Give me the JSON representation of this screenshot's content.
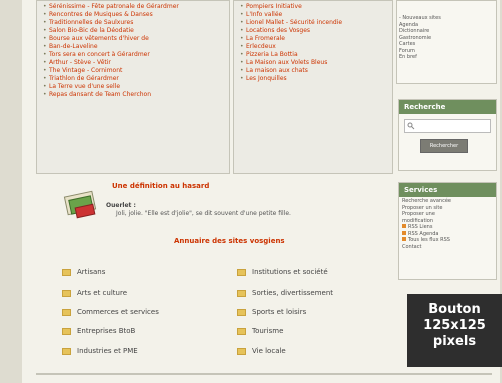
{
  "left_links": [
    "Sérénissime - Fête patronale de Gérardmer",
    "Rencontres de Musiques & Danses",
    "Traditionnelles de Saulxures",
    "Salon Bio-Bic de la Déodatie",
    "Bourse aux vêtements d'hiver de",
    "Ban-de-Laveline",
    "Tors sera en concert à Gérardmer",
    "Arthur - Stève - Vêtir",
    "The Vintage - Cornimont",
    "Triathlon de Gérardmer",
    "La Terre vue d'une selle",
    "Repas dansant de Team Cherchon"
  ],
  "middle_links": [
    "Pompiers Initiative",
    "L'Info vallée",
    "Lionel Mallet - Sécurité incendie",
    "Locations des Vosges",
    "La Fromerale",
    "Erlecdeux",
    "Pizzeria La Bottia",
    "La Maison aux Volets Bleus",
    "La maison aux chats",
    "Les Jonquilles"
  ],
  "sidebar_top": [
    "- Nouveaux sites",
    "Agenda",
    "Dictionnaire",
    "Gastronomie",
    "Cartes",
    "Forum",
    "En bref"
  ],
  "recherche": {
    "title": "Recherche",
    "button": "Rechercher"
  },
  "services": {
    "title": "Services",
    "items": [
      "Recherche avancée",
      "Proposer un site",
      "Proposer une",
      "modification"
    ],
    "rss": [
      "RSS Liens",
      "RSS Agenda",
      "Tous les flux RSS"
    ],
    "contact": "Contact"
  },
  "definition": {
    "title": "Une définition au hasard",
    "word": "Ouerlet :",
    "text": "Joli, jolie. \"Elle est d'jolie\", se dit souvent d'une petite fille."
  },
  "annuaire": {
    "title": "Annuaire des sites vosgiens",
    "left": [
      "Artisans",
      "Arts et culture",
      "Commerces et services",
      "Entreprises BtoB",
      "Industries et PME"
    ],
    "right": [
      "Institutions et société",
      "Sorties, divertissement",
      "Sports et loisirs",
      "Tourisme",
      "Vie locale"
    ]
  },
  "ad": {
    "line1": "Bouton",
    "line2": "125x125",
    "line3": "pixels"
  }
}
